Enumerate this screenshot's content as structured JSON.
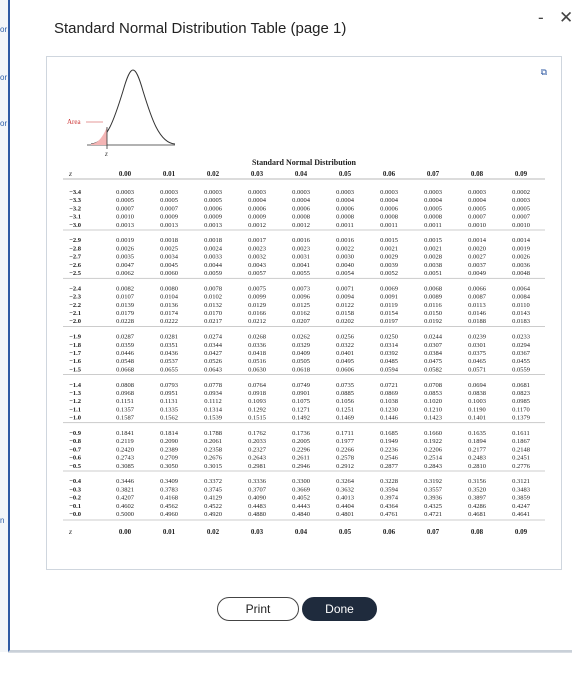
{
  "dialog": {
    "title": "Standard Normal Distribution Table (page 1)"
  },
  "window": {
    "minimize": "-",
    "close": "✕"
  },
  "buttons": {
    "print": "Print",
    "done": "Done"
  },
  "figure": {
    "area_label": "Area",
    "z_label": "z"
  },
  "table": {
    "title": "Standard Normal Distribution",
    "z_header": "z",
    "columns": [
      "0.00",
      "0.01",
      "0.02",
      "0.03",
      "0.04",
      "0.05",
      "0.06",
      "0.07",
      "0.08",
      "0.09"
    ],
    "groups": [
      [
        [
          "−3.4",
          "0.0003",
          "0.0003",
          "0.0003",
          "0.0003",
          "0.0003",
          "0.0003",
          "0.0003",
          "0.0003",
          "0.0003",
          "0.0002"
        ],
        [
          "−3.3",
          "0.0005",
          "0.0005",
          "0.0005",
          "0.0004",
          "0.0004",
          "0.0004",
          "0.0004",
          "0.0004",
          "0.0004",
          "0.0003"
        ],
        [
          "−3.2",
          "0.0007",
          "0.0007",
          "0.0006",
          "0.0006",
          "0.0006",
          "0.0006",
          "0.0006",
          "0.0005",
          "0.0005",
          "0.0005"
        ],
        [
          "−3.1",
          "0.0010",
          "0.0009",
          "0.0009",
          "0.0009",
          "0.0008",
          "0.0008",
          "0.0008",
          "0.0008",
          "0.0007",
          "0.0007"
        ],
        [
          "−3.0",
          "0.0013",
          "0.0013",
          "0.0013",
          "0.0012",
          "0.0012",
          "0.0011",
          "0.0011",
          "0.0011",
          "0.0010",
          "0.0010"
        ]
      ],
      [
        [
          "−2.9",
          "0.0019",
          "0.0018",
          "0.0018",
          "0.0017",
          "0.0016",
          "0.0016",
          "0.0015",
          "0.0015",
          "0.0014",
          "0.0014"
        ],
        [
          "−2.8",
          "0.0026",
          "0.0025",
          "0.0024",
          "0.0023",
          "0.0023",
          "0.0022",
          "0.0021",
          "0.0021",
          "0.0020",
          "0.0019"
        ],
        [
          "−2.7",
          "0.0035",
          "0.0034",
          "0.0033",
          "0.0032",
          "0.0031",
          "0.0030",
          "0.0029",
          "0.0028",
          "0.0027",
          "0.0026"
        ],
        [
          "−2.6",
          "0.0047",
          "0.0045",
          "0.0044",
          "0.0043",
          "0.0041",
          "0.0040",
          "0.0039",
          "0.0038",
          "0.0037",
          "0.0036"
        ],
        [
          "−2.5",
          "0.0062",
          "0.0060",
          "0.0059",
          "0.0057",
          "0.0055",
          "0.0054",
          "0.0052",
          "0.0051",
          "0.0049",
          "0.0048"
        ]
      ],
      [
        [
          "−2.4",
          "0.0082",
          "0.0080",
          "0.0078",
          "0.0075",
          "0.0073",
          "0.0071",
          "0.0069",
          "0.0068",
          "0.0066",
          "0.0064"
        ],
        [
          "−2.3",
          "0.0107",
          "0.0104",
          "0.0102",
          "0.0099",
          "0.0096",
          "0.0094",
          "0.0091",
          "0.0089",
          "0.0087",
          "0.0084"
        ],
        [
          "−2.2",
          "0.0139",
          "0.0136",
          "0.0132",
          "0.0129",
          "0.0125",
          "0.0122",
          "0.0119",
          "0.0116",
          "0.0113",
          "0.0110"
        ],
        [
          "−2.1",
          "0.0179",
          "0.0174",
          "0.0170",
          "0.0166",
          "0.0162",
          "0.0158",
          "0.0154",
          "0.0150",
          "0.0146",
          "0.0143"
        ],
        [
          "−2.0",
          "0.0228",
          "0.0222",
          "0.0217",
          "0.0212",
          "0.0207",
          "0.0202",
          "0.0197",
          "0.0192",
          "0.0188",
          "0.0183"
        ]
      ],
      [
        [
          "−1.9",
          "0.0287",
          "0.0281",
          "0.0274",
          "0.0268",
          "0.0262",
          "0.0256",
          "0.0250",
          "0.0244",
          "0.0239",
          "0.0233"
        ],
        [
          "−1.8",
          "0.0359",
          "0.0351",
          "0.0344",
          "0.0336",
          "0.0329",
          "0.0322",
          "0.0314",
          "0.0307",
          "0.0301",
          "0.0294"
        ],
        [
          "−1.7",
          "0.0446",
          "0.0436",
          "0.0427",
          "0.0418",
          "0.0409",
          "0.0401",
          "0.0392",
          "0.0384",
          "0.0375",
          "0.0367"
        ],
        [
          "−1.6",
          "0.0548",
          "0.0537",
          "0.0526",
          "0.0516",
          "0.0505",
          "0.0495",
          "0.0485",
          "0.0475",
          "0.0465",
          "0.0455"
        ],
        [
          "−1.5",
          "0.0668",
          "0.0655",
          "0.0643",
          "0.0630",
          "0.0618",
          "0.0606",
          "0.0594",
          "0.0582",
          "0.0571",
          "0.0559"
        ]
      ],
      [
        [
          "−1.4",
          "0.0808",
          "0.0793",
          "0.0778",
          "0.0764",
          "0.0749",
          "0.0735",
          "0.0721",
          "0.0708",
          "0.0694",
          "0.0681"
        ],
        [
          "−1.3",
          "0.0968",
          "0.0951",
          "0.0934",
          "0.0918",
          "0.0901",
          "0.0885",
          "0.0869",
          "0.0853",
          "0.0838",
          "0.0823"
        ],
        [
          "−1.2",
          "0.1151",
          "0.1131",
          "0.1112",
          "0.1093",
          "0.1075",
          "0.1056",
          "0.1038",
          "0.1020",
          "0.1003",
          "0.0985"
        ],
        [
          "−1.1",
          "0.1357",
          "0.1335",
          "0.1314",
          "0.1292",
          "0.1271",
          "0.1251",
          "0.1230",
          "0.1210",
          "0.1190",
          "0.1170"
        ],
        [
          "−1.0",
          "0.1587",
          "0.1562",
          "0.1539",
          "0.1515",
          "0.1492",
          "0.1469",
          "0.1446",
          "0.1423",
          "0.1401",
          "0.1379"
        ]
      ],
      [
        [
          "−0.9",
          "0.1841",
          "0.1814",
          "0.1788",
          "0.1762",
          "0.1736",
          "0.1711",
          "0.1685",
          "0.1660",
          "0.1635",
          "0.1611"
        ],
        [
          "−0.8",
          "0.2119",
          "0.2090",
          "0.2061",
          "0.2033",
          "0.2005",
          "0.1977",
          "0.1949",
          "0.1922",
          "0.1894",
          "0.1867"
        ],
        [
          "−0.7",
          "0.2420",
          "0.2389",
          "0.2358",
          "0.2327",
          "0.2296",
          "0.2266",
          "0.2236",
          "0.2206",
          "0.2177",
          "0.2148"
        ],
        [
          "−0.6",
          "0.2743",
          "0.2709",
          "0.2676",
          "0.2643",
          "0.2611",
          "0.2578",
          "0.2546",
          "0.2514",
          "0.2483",
          "0.2451"
        ],
        [
          "−0.5",
          "0.3085",
          "0.3050",
          "0.3015",
          "0.2981",
          "0.2946",
          "0.2912",
          "0.2877",
          "0.2843",
          "0.2810",
          "0.2776"
        ]
      ],
      [
        [
          "−0.4",
          "0.3446",
          "0.3409",
          "0.3372",
          "0.3336",
          "0.3300",
          "0.3264",
          "0.3228",
          "0.3192",
          "0.3156",
          "0.3121"
        ],
        [
          "−0.3",
          "0.3821",
          "0.3783",
          "0.3745",
          "0.3707",
          "0.3669",
          "0.3632",
          "0.3594",
          "0.3557",
          "0.3520",
          "0.3483"
        ],
        [
          "−0.2",
          "0.4207",
          "0.4168",
          "0.4129",
          "0.4090",
          "0.4052",
          "0.4013",
          "0.3974",
          "0.3936",
          "0.3897",
          "0.3859"
        ],
        [
          "−0.1",
          "0.4602",
          "0.4562",
          "0.4522",
          "0.4483",
          "0.4443",
          "0.4404",
          "0.4364",
          "0.4325",
          "0.4286",
          "0.4247"
        ],
        [
          "−0.0",
          "0.5000",
          "0.4960",
          "0.4920",
          "0.4880",
          "0.4840",
          "0.4801",
          "0.4761",
          "0.4721",
          "0.4681",
          "0.4641"
        ]
      ]
    ]
  }
}
